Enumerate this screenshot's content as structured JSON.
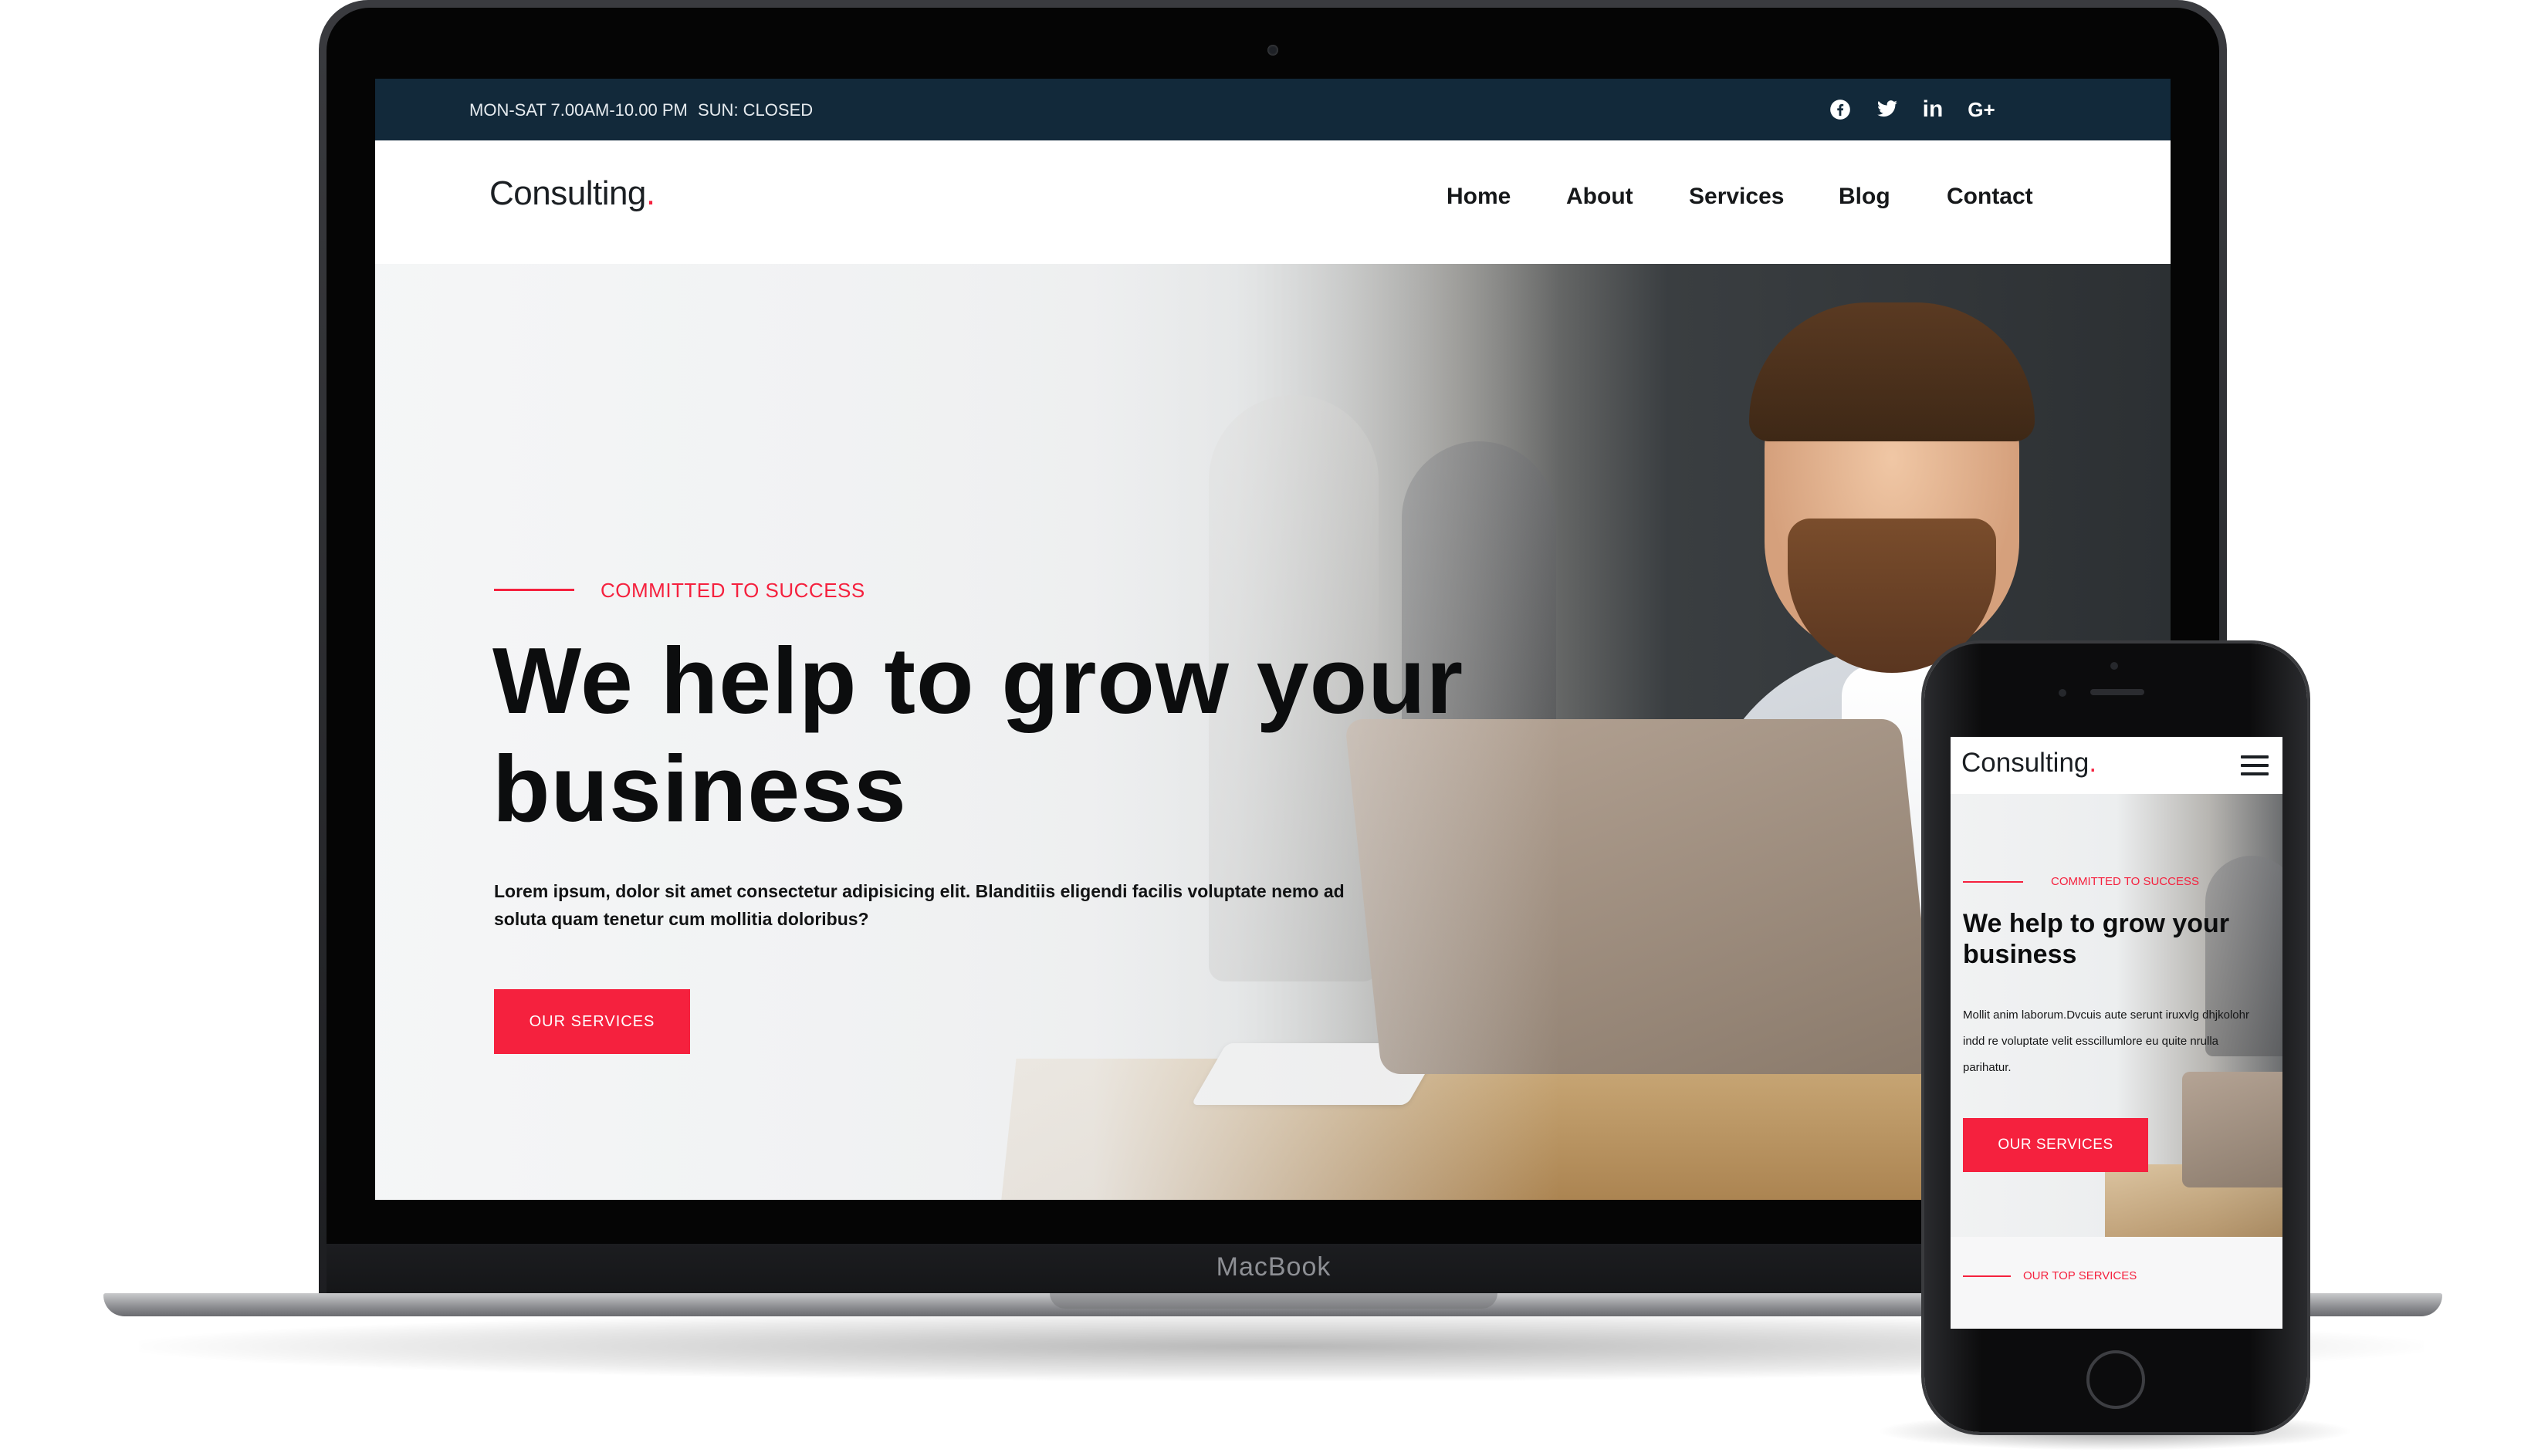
{
  "laptop": {
    "brand_label": "MacBook"
  },
  "topbar": {
    "hours": "MON-SAT 7.00AM-10.00 PM",
    "closed": "SUN: CLOSED",
    "social": [
      "facebook-icon",
      "twitter-icon",
      "linkedin-icon",
      "google-plus-icon"
    ],
    "linkedin_text": "in",
    "googleplus_text": "G+"
  },
  "navbar": {
    "logo": "Consulting",
    "logo_dot": ".",
    "items": [
      "Home",
      "About",
      "Services",
      "Blog",
      "Contact"
    ]
  },
  "hero": {
    "kicker": "COMMITTED TO SUCCESS",
    "title": "We help to grow your business",
    "text": "Lorem ipsum, dolor sit amet consectetur adipisicing elit. Blanditiis eligendi facilis voluptate nemo ad soluta quam tenetur cum mollitia doloribus?",
    "button": "OUR SERVICES"
  },
  "mobile": {
    "logo": "Consulting",
    "logo_dot": ".",
    "kicker": "COMMITTED TO SUCCESS",
    "title": "We help to grow your business",
    "text": "Mollit anim laborum.Dvcuis aute serunt iruxvlg dhjkolohr indd re voluptate velit esscillumlore eu quite nrulla parihatur.",
    "button": "OUR SERVICES",
    "section_kicker": "OUR TOP SERVICES"
  },
  "colors": {
    "accent": "#f5213e",
    "topbar": "#12293a",
    "heading": "#0c0d0e"
  }
}
